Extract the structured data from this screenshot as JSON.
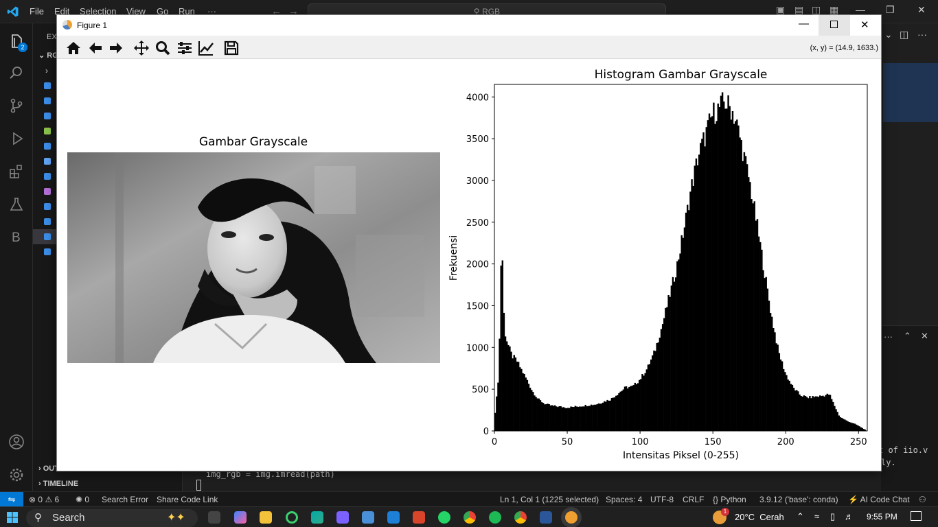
{
  "vscode": {
    "menu": [
      "File",
      "Edit",
      "Selection",
      "View",
      "Go",
      "Run",
      "···"
    ],
    "search": "RGB",
    "explorer_header": "EXPLORER",
    "folder_label": "RGB",
    "outline": "OUTLINE",
    "timeline": "TIMELINE",
    "code_line": "img_rgb = img.imread(path)",
    "panel_text_1": "t of iio.v",
    "panel_text_2": "ly.",
    "scm_badge": "2",
    "activity_letter": "B"
  },
  "status": {
    "errors": "0",
    "warnings": "6",
    "ports": "0",
    "search_error": "Search Error",
    "share": "Share Code Link",
    "cursor": "Ln 1, Col 1 (1225 selected)",
    "spaces": "Spaces: 4",
    "encoding": "UTF-8",
    "eol": "CRLF",
    "language": "Python",
    "interpreter": "3.9.12 ('base': conda)",
    "ai": "AI Code Chat"
  },
  "taskbar": {
    "search": "Search",
    "weather": "20°C  Cerah",
    "weather_badge": "1",
    "time": "9:55 PM"
  },
  "figure": {
    "window_title": "Figure 1",
    "coords": "(x, y) = (14.9, 1633.)",
    "image_title": "Gambar Grayscale",
    "tools": [
      "home-icon",
      "back-icon",
      "forward-icon",
      "pan-icon",
      "zoom-icon",
      "configure-subplots-icon",
      "edit-axis-icon",
      "save-icon"
    ]
  },
  "chart_data": {
    "type": "bar",
    "title": "Histogram Gambar Grayscale",
    "xlabel": "Intensitas Piksel (0-255)",
    "ylabel": "Frekuensi",
    "xlim": [
      0,
      256
    ],
    "ylim": [
      0,
      4150
    ],
    "xticks": [
      0,
      50,
      100,
      150,
      200,
      250
    ],
    "yticks": [
      0,
      500,
      1000,
      1500,
      2000,
      2500,
      3000,
      3500,
      4000
    ],
    "bins": 256,
    "color": "#000000",
    "profile": [
      [
        0,
        150
      ],
      [
        1,
        300
      ],
      [
        3,
        700
      ],
      [
        4,
        1500
      ],
      [
        5,
        2500
      ],
      [
        6,
        1600
      ],
      [
        7,
        1200
      ],
      [
        9,
        1050
      ],
      [
        12,
        900
      ],
      [
        15,
        850
      ],
      [
        18,
        750
      ],
      [
        22,
        620
      ],
      [
        26,
        480
      ],
      [
        30,
        380
      ],
      [
        35,
        320
      ],
      [
        40,
        300
      ],
      [
        50,
        280
      ],
      [
        60,
        300
      ],
      [
        70,
        320
      ],
      [
        80,
        380
      ],
      [
        85,
        450
      ],
      [
        90,
        520
      ],
      [
        95,
        530
      ],
      [
        100,
        620
      ],
      [
        105,
        750
      ],
      [
        110,
        950
      ],
      [
        115,
        1250
      ],
      [
        120,
        1600
      ],
      [
        125,
        1950
      ],
      [
        130,
        2400
      ],
      [
        135,
        2900
      ],
      [
        140,
        3300
      ],
      [
        145,
        3550
      ],
      [
        150,
        3800
      ],
      [
        155,
        3880
      ],
      [
        158,
        3950
      ],
      [
        160,
        3900
      ],
      [
        163,
        3850
      ],
      [
        166,
        3700
      ],
      [
        170,
        3400
      ],
      [
        175,
        3000
      ],
      [
        180,
        2500
      ],
      [
        185,
        1950
      ],
      [
        190,
        1400
      ],
      [
        195,
        950
      ],
      [
        200,
        680
      ],
      [
        205,
        520
      ],
      [
        210,
        430
      ],
      [
        215,
        400
      ],
      [
        220,
        410
      ],
      [
        225,
        420
      ],
      [
        230,
        440
      ],
      [
        233,
        320
      ],
      [
        237,
        170
      ],
      [
        242,
        120
      ],
      [
        248,
        80
      ],
      [
        252,
        40
      ],
      [
        255,
        10
      ]
    ]
  }
}
